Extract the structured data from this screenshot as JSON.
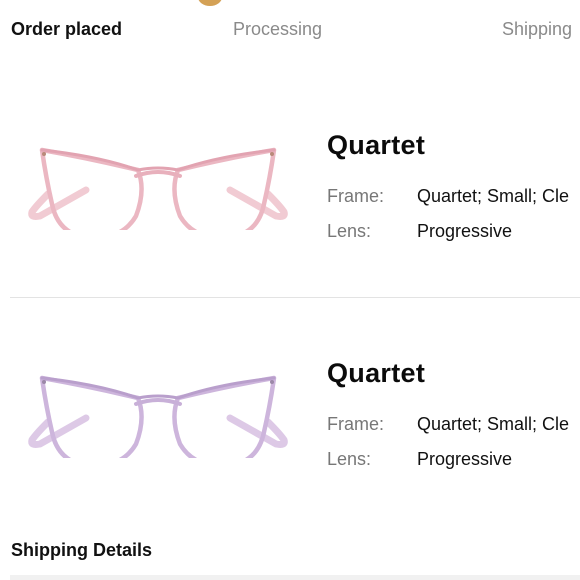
{
  "progress": {
    "steps": [
      "Order placed",
      "Processing",
      "Shipping"
    ],
    "active_step": "Order placed",
    "accent_color": "#d4a156"
  },
  "items": [
    {
      "image": "cat-eye-glasses-pink",
      "name": "Quartet",
      "frame_label": "Frame:",
      "frame_value": "Quartet; Small; Cle",
      "lens_label": "Lens:",
      "lens_value": "Progressive",
      "frame_color": "#e8b4bf"
    },
    {
      "image": "cat-eye-glasses-lavender",
      "name": "Quartet",
      "frame_label": "Frame:",
      "frame_value": "Quartet; Small; Cle",
      "lens_label": "Lens:",
      "lens_value": "Progressive",
      "frame_color": "#c8b0d8"
    }
  ],
  "shipping": {
    "title": "Shipping Details"
  }
}
